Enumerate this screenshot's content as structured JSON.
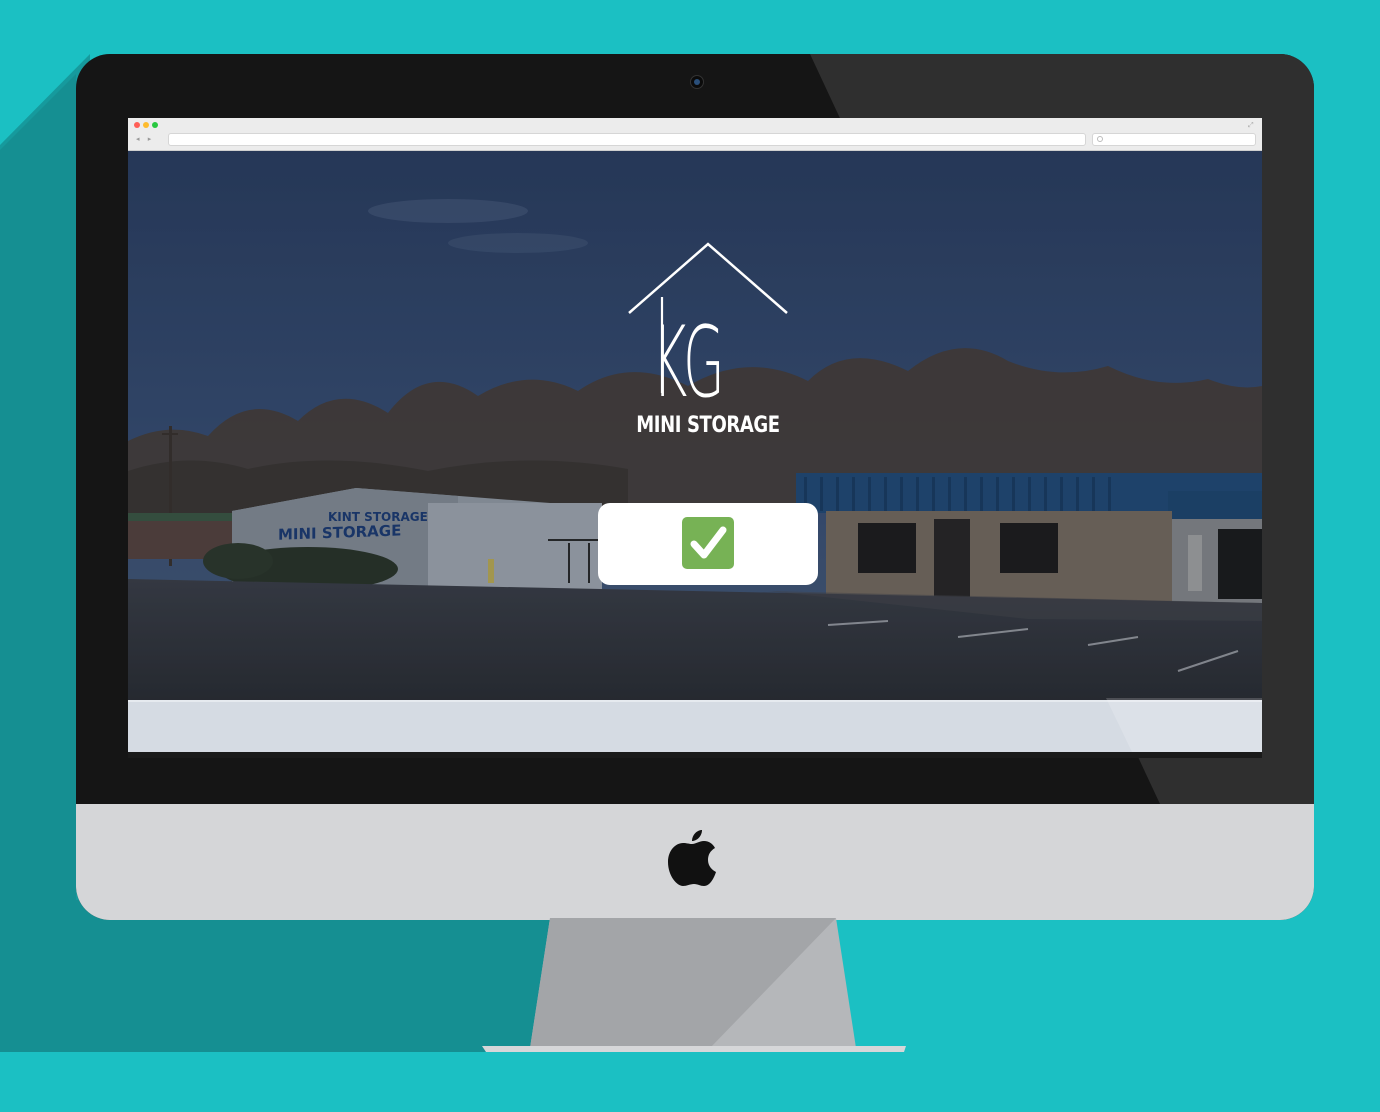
{
  "colors": {
    "background": "#1bc0c3",
    "background_shadow": "#158f92",
    "bezel": "#151515",
    "chin": "#d5d6d8",
    "check_green": "#77b255"
  },
  "monitor": {
    "camera_icon": "webcam",
    "logo_icon": "apple-logo-icon"
  },
  "browser": {
    "window_controls": [
      "close",
      "minimize",
      "zoom"
    ],
    "nav_icons": [
      "back-arrow-icon",
      "forward-arrow-icon"
    ],
    "url": "",
    "search_placeholder": ""
  },
  "site": {
    "logo_letters": "KG",
    "brand_name": "MINI STORAGE",
    "status_icon": "check-mark-icon",
    "hero_photo_signage": "MINI STORAGE"
  }
}
